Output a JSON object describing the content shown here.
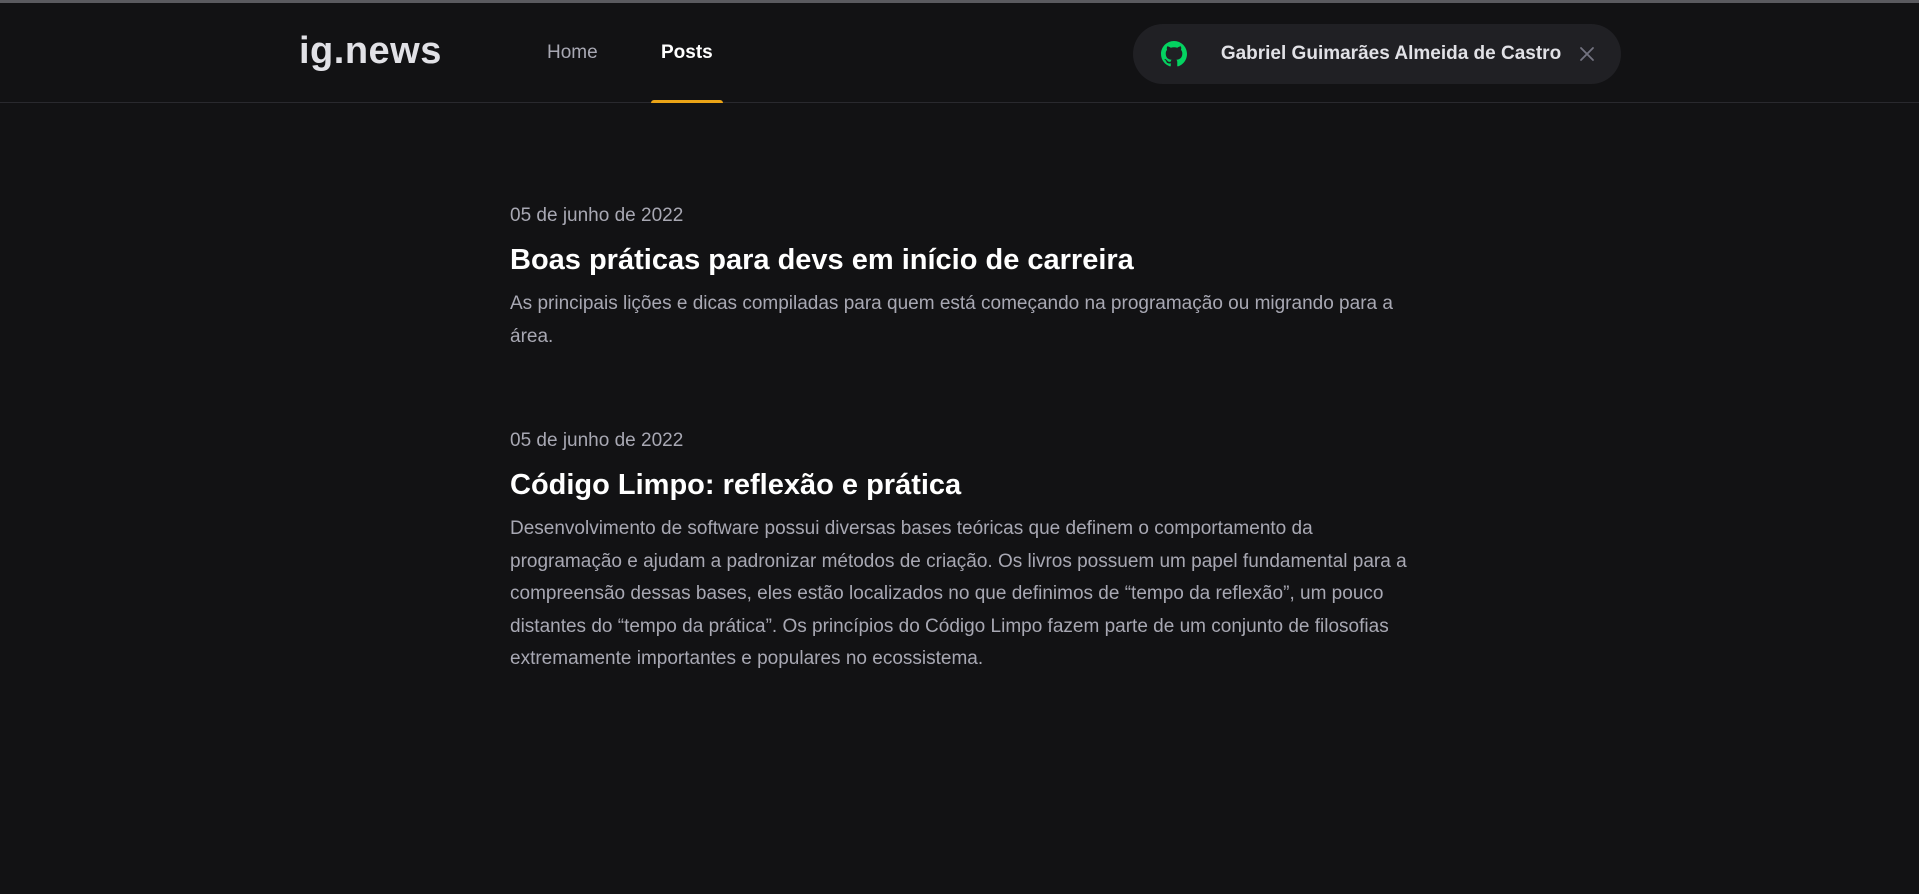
{
  "header": {
    "logo": "ig.news",
    "nav": [
      {
        "label": "Home",
        "active": false
      },
      {
        "label": "Posts",
        "active": true
      }
    ],
    "user": {
      "name": "Gabriel Guimarães Almeida de Castro",
      "icon": "github-icon",
      "icon_color": "#04d361",
      "close_icon": "close-icon"
    }
  },
  "colors": {
    "background": "#121214",
    "accent": "#eba417",
    "text_primary": "#ffffff",
    "text_secondary": "#a8a8b3"
  },
  "posts": [
    {
      "date": "05 de junho de 2022",
      "title": "Boas práticas para devs em início de carreira",
      "excerpt": "As principais lições e dicas compiladas para quem está começando na programação ou migrando para a área."
    },
    {
      "date": "05 de junho de 2022",
      "title": "Código Limpo: reflexão e prática",
      "excerpt": "Desenvolvimento de software possui diversas bases teóricas que definem o comportamento da programação e ajudam a padronizar métodos de criação. Os livros possuem um papel fundamental para a compreensão dessas bases, eles estão localizados no que definimos de “tempo da reflexão”, um pouco distantes do “tempo da prática”. Os princípios do Código Limpo fazem parte de um conjunto de filosofias extremamente importantes e populares no ecossistema."
    }
  ]
}
